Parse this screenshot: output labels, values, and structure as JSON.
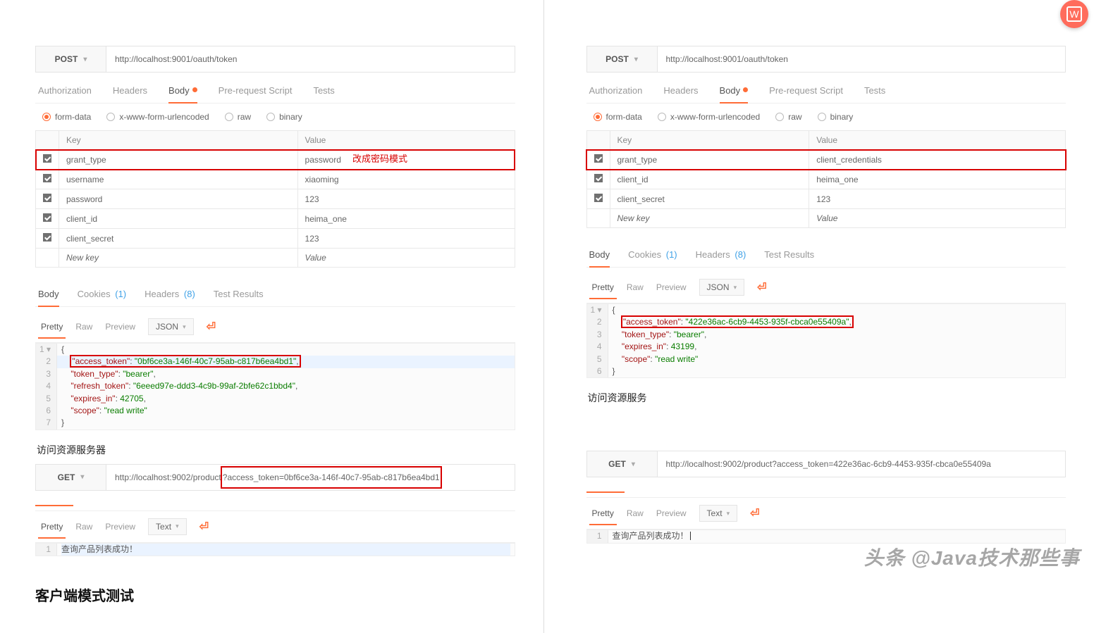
{
  "left": {
    "method": "POST",
    "url": "http://localhost:9001/oauth/token",
    "tabs1": [
      "Authorization",
      "Headers",
      "Body",
      "Pre-request Script",
      "Tests"
    ],
    "tabs1_active": "Body",
    "body_mode": "form-data",
    "body_modes": [
      "form-data",
      "x-www-form-urlencoded",
      "raw",
      "binary"
    ],
    "table_headers": {
      "key": "Key",
      "value": "Value"
    },
    "params": [
      {
        "key": "grant_type",
        "value": "password"
      },
      {
        "key": "username",
        "value": "xiaoming"
      },
      {
        "key": "password",
        "value": "123"
      },
      {
        "key": "client_id",
        "value": "heima_one"
      },
      {
        "key": "client_secret",
        "value": "123"
      }
    ],
    "new_key": "New key",
    "new_value": "Value",
    "note": "改成密码模式",
    "tabs2": {
      "body": "Body",
      "cookies": "Cookies",
      "cookies_n": "(1)",
      "headers": "Headers",
      "headers_n": "(8)",
      "tests": "Test Results"
    },
    "prettybar": {
      "pretty": "Pretty",
      "raw": "Raw",
      "preview": "Preview",
      "format": "JSON"
    },
    "json_lines": [
      "{",
      "\"access_token\": \"0bf6ce3a-146f-40c7-95ab-c817b6ea4bd1\",",
      "\"token_type\": \"bearer\",",
      "\"refresh_token\": \"6eeed97e-ddd3-4c9b-99af-2bfe62c1bbd4\",",
      "\"expires_in\": 42705,",
      "\"scope\": \"read write\"",
      "}"
    ],
    "section_title": "访问资源服务器",
    "get": {
      "method": "GET",
      "url": "http://localhost:9002/product?access_token=0bf6ce3a-146f-40c7-95ab-c817b6ea4bd1"
    },
    "get_highlight": "?access_token=0bf6ce3a-146f-40c7-95ab-c817b6ea4bd1",
    "prettybar2": {
      "pretty": "Pretty",
      "raw": "Raw",
      "preview": "Preview",
      "format": "Text"
    },
    "result_line": "查询产品列表成功！",
    "big_title": "客户端模式测试"
  },
  "right": {
    "method": "POST",
    "url": "http://localhost:9001/oauth/token",
    "tabs1": [
      "Authorization",
      "Headers",
      "Body",
      "Pre-request Script",
      "Tests"
    ],
    "tabs1_active": "Body",
    "body_mode": "form-data",
    "body_modes": [
      "form-data",
      "x-www-form-urlencoded",
      "raw",
      "binary"
    ],
    "table_headers": {
      "key": "Key",
      "value": "Value"
    },
    "params": [
      {
        "key": "grant_type",
        "value": "client_credentials"
      },
      {
        "key": "client_id",
        "value": "heima_one"
      },
      {
        "key": "client_secret",
        "value": "123"
      }
    ],
    "new_key": "New key",
    "new_value": "Value",
    "tabs2": {
      "body": "Body",
      "cookies": "Cookies",
      "cookies_n": "(1)",
      "headers": "Headers",
      "headers_n": "(8)",
      "tests": "Test Results"
    },
    "prettybar": {
      "pretty": "Pretty",
      "raw": "Raw",
      "preview": "Preview",
      "format": "JSON"
    },
    "json_lines": [
      "{",
      "\"access_token\": \"422e36ac-6cb9-4453-935f-cbca0e55409a\",",
      "\"token_type\": \"bearer\",",
      "\"expires_in\": 43199,",
      "\"scope\": \"read write\"",
      "}"
    ],
    "section_title": "访问资源服务",
    "get": {
      "method": "GET",
      "url": "http://localhost:9002/product?access_token=422e36ac-6cb9-4453-935f-cbca0e55409a"
    },
    "prettybar2": {
      "pretty": "Pretty",
      "raw": "Raw",
      "preview": "Preview",
      "format": "Text"
    },
    "result_line": "查询产品列表成功！"
  },
  "watermark": "头条 @Java技术那些事",
  "badge_letter": "W"
}
